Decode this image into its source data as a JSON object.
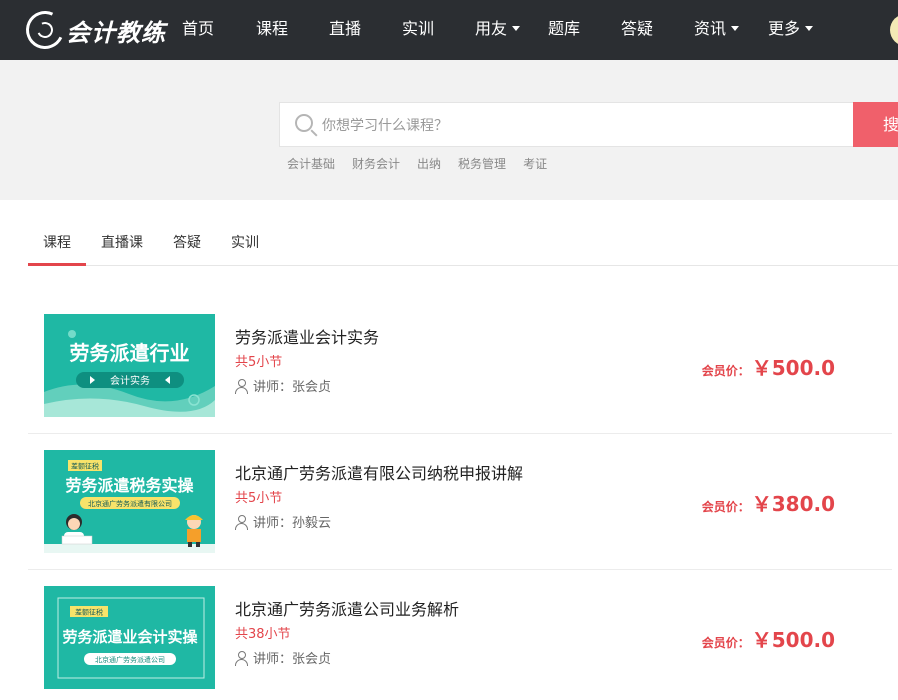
{
  "header": {
    "logo_text": "会计教练",
    "nav": [
      {
        "label": "首页",
        "dropdown": false
      },
      {
        "label": "课程",
        "dropdown": false
      },
      {
        "label": "直播",
        "dropdown": false
      },
      {
        "label": "实训",
        "dropdown": false
      },
      {
        "label": "用友",
        "dropdown": true
      },
      {
        "label": "题库",
        "dropdown": false
      },
      {
        "label": "答疑",
        "dropdown": false
      },
      {
        "label": "资讯",
        "dropdown": true
      },
      {
        "label": "更多",
        "dropdown": true
      }
    ]
  },
  "search": {
    "placeholder": "你想学习什么课程？",
    "button_label": "搜索",
    "hot_tags": [
      "会计基础",
      "财务会计",
      "出纳",
      "税务管理",
      "考证"
    ]
  },
  "tabs": [
    "课程",
    "直播课",
    "答疑",
    "实训"
  ],
  "active_tab": 0,
  "courses": [
    {
      "title": "劳务派遣业会计实务",
      "lessons": "共5小节",
      "teacher": "讲师：张会贞",
      "price_label": "会员价：",
      "price": "￥500.0",
      "thumb": {
        "headline": "劳务派遣行业",
        "sub": "会计实务",
        "badge": "",
        "banner": ""
      }
    },
    {
      "title": "北京通广劳务派遣有限公司纳税申报讲解",
      "lessons": "共5小节",
      "teacher": "讲师：孙毅云",
      "price_label": "会员价：",
      "price": "￥380.0",
      "thumb": {
        "headline": "劳务派遣税务实操",
        "sub": "",
        "badge": "差额征税",
        "banner": "北京通广劳务派遣有限公司"
      }
    },
    {
      "title": "北京通广劳务派遣公司业务解析",
      "lessons": "共38小节",
      "teacher": "讲师：张会贞",
      "price_label": "会员价：",
      "price": "￥500.0",
      "thumb": {
        "headline": "劳务派遣业会计实操",
        "sub": "",
        "badge": "差额征税",
        "banner": "北京通广劳务派遣公司"
      }
    }
  ],
  "colors": {
    "nav_bg": "#2b2e32",
    "accent": "#e3454b",
    "search_button": "#f0606b",
    "thumb_teal": "#1fb8a4"
  }
}
